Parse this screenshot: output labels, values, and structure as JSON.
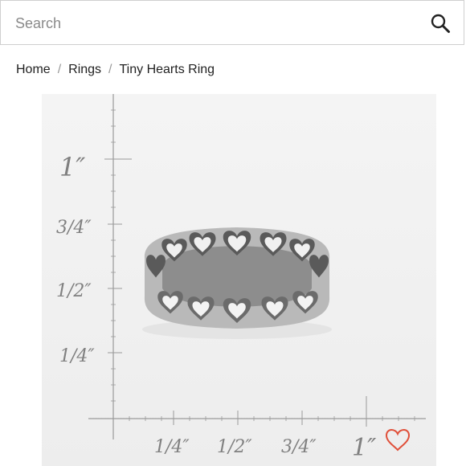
{
  "search": {
    "placeholder": "Search",
    "value": "",
    "icon": "search-icon"
  },
  "breadcrumb": {
    "items": [
      {
        "label": "Home"
      },
      {
        "label": "Rings"
      },
      {
        "label": "Tiny Hearts Ring"
      }
    ],
    "separator": "/"
  },
  "product_image": {
    "scale_y_labels": [
      "1″",
      "3/4″",
      "1/2″",
      "1/4″"
    ],
    "scale_x_labels": [
      "1/4″",
      "1/2″",
      "3/4″",
      "1″"
    ]
  },
  "like": {
    "icon": "heart-outline-icon",
    "color": "#e0503a"
  },
  "colors": {
    "border": "#cfcfcf",
    "image_background": "#f1f1f1",
    "ruler": "#9a9a9a"
  }
}
